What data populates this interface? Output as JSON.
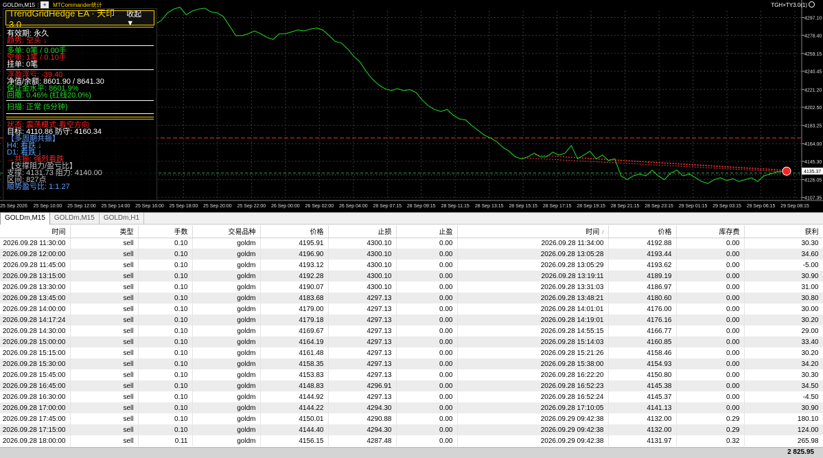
{
  "chart": {
    "symbol_tab": "GOLDm,M15",
    "plus_label": "+",
    "indicator_tab": "MTCommander统计",
    "ea_label": "TGH×TY3.0(1)",
    "current_price": "4135.37",
    "price_axis": [
      "4297.10",
      "4278.40",
      "4259.15",
      "4240.45",
      "4221.20",
      "4202.50",
      "4183.25",
      "4164.00",
      "4145.30",
      "4126.05",
      "4107.35"
    ],
    "time_axis": [
      "25 Sep 2026",
      "25 Sep 10:00",
      "25 Sep 12:00",
      "25 Sep 14:00",
      "25 Sep 16:00",
      "25 Sep 18:00",
      "25 Sep 20:00",
      "25 Sep 22:00",
      "26 Sep 00:00",
      "26 Sep 02:00",
      "26 Sep 04:00",
      "28 Sep 07:15",
      "28 Sep 09:15",
      "28 Sep 11:15",
      "28 Sep 13:15",
      "28 Sep 15:15",
      "28 Sep 17:15",
      "28 Sep 19:15",
      "28 Sep 21:15",
      "28 Sep 23:15",
      "29 Sep 01:15",
      "29 Sep 03:15",
      "29 Sep 06:15",
      "29 Sep 08:15"
    ],
    "price_series": [
      4290,
      4294,
      4302,
      4306,
      4308,
      4300,
      4304,
      4306,
      4307,
      4303,
      4302,
      4298,
      4288,
      4278,
      4278,
      4280,
      4283,
      4280,
      4276,
      4274,
      4280,
      4280,
      4282,
      4284,
      4283,
      4285,
      4286,
      4284,
      4278,
      4272,
      4270,
      4264,
      4256,
      4250,
      4240,
      4232,
      4226,
      4222,
      4220,
      4222,
      4220,
      4221,
      4218,
      4210,
      4204,
      4200,
      4198,
      4200,
      4194,
      4190,
      4189,
      4183,
      4178,
      4173,
      4170,
      4166,
      4160,
      4156,
      4150,
      4148,
      4150,
      4154,
      4150,
      4150,
      4155,
      4152,
      4154,
      4162,
      4148,
      4152,
      4156,
      4148,
      4152,
      4146,
      4148,
      4130,
      4126,
      4130,
      4132,
      4130,
      4136,
      4130,
      4126,
      4133,
      4136,
      4130,
      4132,
      4128,
      4124,
      4122,
      4126,
      4128,
      4125,
      4127,
      4124,
      4126,
      4128,
      4124,
      4130,
      4132,
      4134,
      4135
    ],
    "colors": {
      "background": "#000000",
      "grid": "#3a3a3a",
      "price_line": "#22dd22",
      "stop_line": "#ff3030",
      "bid_line": "#22aa55"
    }
  },
  "ea_panel": {
    "title": "TrendGridHedge EA · 天印3.0",
    "collapse": "收起 ▼",
    "validity": "有效期: 永久",
    "trend": "趋势: 空头 ↓",
    "long_orders": "多单: 0笔 / 0.00手",
    "short_orders": "空单: 1笔 / 0.10手",
    "pending_orders": "挂单: 0笔",
    "floating_pl": "浮盈浮亏: -39.40",
    "equity_balance": "净值/余额: 8601.90 / 8641.30",
    "margin_level": "保证金水平: 8601.9%",
    "drawdown": "回撤: 0.46% (红线20.0%)",
    "scan": "扫描: 正常 (5分钟)",
    "status": "状态: 震荡模式·看空方向",
    "target": "目标: 4110.86  防守: 4160.34",
    "multi_tf": "【多周期共振】",
    "h4": "H4: 看跌 ↓",
    "d1": "D1: 看跌 ↓",
    "resonance": "→共振: 强烈看跌",
    "sr_header": "【支撑阻力/盈亏比】",
    "support_resist": "支撑: 4131.73  阻力: 4140.00",
    "range": "区间: 827点",
    "rr_ratio": "顺势盈亏比: 1:1.27"
  },
  "chart_tabs": [
    "GOLDm,M15",
    "GOLDm,M15",
    "GOLDm,H1"
  ],
  "table": {
    "headers": [
      "时间",
      "类型",
      "手数",
      "交易品种",
      "价格",
      "止损",
      "止盈",
      "时间",
      "价格",
      "库存费",
      "获利"
    ],
    "sort_indicator": "/",
    "rows": [
      [
        "2026.09.28 11:30:00",
        "sell",
        "0.10",
        "goldm",
        "4195.91",
        "4300.10",
        "0.00",
        "2026.09.28 11:34:00",
        "4192.88",
        "0.00",
        "30.30"
      ],
      [
        "2026.09.28 12:00:00",
        "sell",
        "0.10",
        "goldm",
        "4196.90",
        "4300.10",
        "0.00",
        "2026.09.28 13:05:28",
        "4193.44",
        "0.00",
        "34.60"
      ],
      [
        "2026.09.28 11:45:00",
        "sell",
        "0.10",
        "goldm",
        "4193.12",
        "4300.10",
        "0.00",
        "2026.09.28 13:05:29",
        "4193.62",
        "0.00",
        "-5.00"
      ],
      [
        "2026.09.28 13:15:00",
        "sell",
        "0.10",
        "goldm",
        "4192.28",
        "4300.10",
        "0.00",
        "2026.09.28 13:19:11",
        "4189.19",
        "0.00",
        "30.90"
      ],
      [
        "2026.09.28 13:30:00",
        "sell",
        "0.10",
        "goldm",
        "4190.07",
        "4300.10",
        "0.00",
        "2026.09.28 13:31:03",
        "4186.97",
        "0.00",
        "31.00"
      ],
      [
        "2026.09.28 13:45:00",
        "sell",
        "0.10",
        "goldm",
        "4183.68",
        "4297.13",
        "0.00",
        "2026.09.28 13:48:21",
        "4180.60",
        "0.00",
        "30.80"
      ],
      [
        "2026.09.28 14:00:00",
        "sell",
        "0.10",
        "goldm",
        "4179.00",
        "4297.13",
        "0.00",
        "2026.09.28 14:01:01",
        "4176.00",
        "0.00",
        "30.00"
      ],
      [
        "2026.09.28 14:17:24",
        "sell",
        "0.10",
        "goldm",
        "4179.18",
        "4297.13",
        "0.00",
        "2026.09.28 14:19:01",
        "4176.16",
        "0.00",
        "30.20"
      ],
      [
        "2026.09.28 14:30:00",
        "sell",
        "0.10",
        "goldm",
        "4169.67",
        "4297.13",
        "0.00",
        "2026.09.28 14:55:15",
        "4166.77",
        "0.00",
        "29.00"
      ],
      [
        "2026.09.28 15:00:00",
        "sell",
        "0.10",
        "goldm",
        "4164.19",
        "4297.13",
        "0.00",
        "2026.09.28 15:14:03",
        "4160.85",
        "0.00",
        "33.40"
      ],
      [
        "2026.09.28 15:15:00",
        "sell",
        "0.10",
        "goldm",
        "4161.48",
        "4297.13",
        "0.00",
        "2026.09.28 15:21:26",
        "4158.46",
        "0.00",
        "30.20"
      ],
      [
        "2026.09.28 15:30:00",
        "sell",
        "0.10",
        "goldm",
        "4158.35",
        "4297.13",
        "0.00",
        "2026.09.28 15:38:00",
        "4154.93",
        "0.00",
        "34.20"
      ],
      [
        "2026.09.28 15:45:00",
        "sell",
        "0.10",
        "goldm",
        "4153.83",
        "4297.13",
        "0.00",
        "2026.09.28 16:22:20",
        "4150.80",
        "0.00",
        "30.30"
      ],
      [
        "2026.09.28 16:45:00",
        "sell",
        "0.10",
        "goldm",
        "4148.83",
        "4296.91",
        "0.00",
        "2026.09.28 16:52:23",
        "4145.38",
        "0.00",
        "34.50"
      ],
      [
        "2026.09.28 16:30:00",
        "sell",
        "0.10",
        "goldm",
        "4144.92",
        "4297.13",
        "0.00",
        "2026.09.28 16:52:24",
        "4145.37",
        "0.00",
        "-4.50"
      ],
      [
        "2026.09.28 17:00:00",
        "sell",
        "0.10",
        "goldm",
        "4144.22",
        "4294.30",
        "0.00",
        "2026.09.28 17:10:05",
        "4141.13",
        "0.00",
        "30.90"
      ],
      [
        "2026.09.28 17:45:00",
        "sell",
        "0.10",
        "goldm",
        "4150.01",
        "4290.88",
        "0.00",
        "2026.09.29 09:42:38",
        "4132.00",
        "0.29",
        "180.10"
      ],
      [
        "2026.09.28 17:15:00",
        "sell",
        "0.10",
        "goldm",
        "4144.40",
        "4294.30",
        "0.00",
        "2026.09.29 09:42:38",
        "4132.00",
        "0.29",
        "124.00"
      ],
      [
        "2026.09.28 18:00:00",
        "sell",
        "0.11",
        "goldm",
        "4156.15",
        "4287.48",
        "0.00",
        "2026.09.29 09:42:38",
        "4131.97",
        "0.32",
        "265.98"
      ]
    ],
    "total": "2 825.95"
  }
}
